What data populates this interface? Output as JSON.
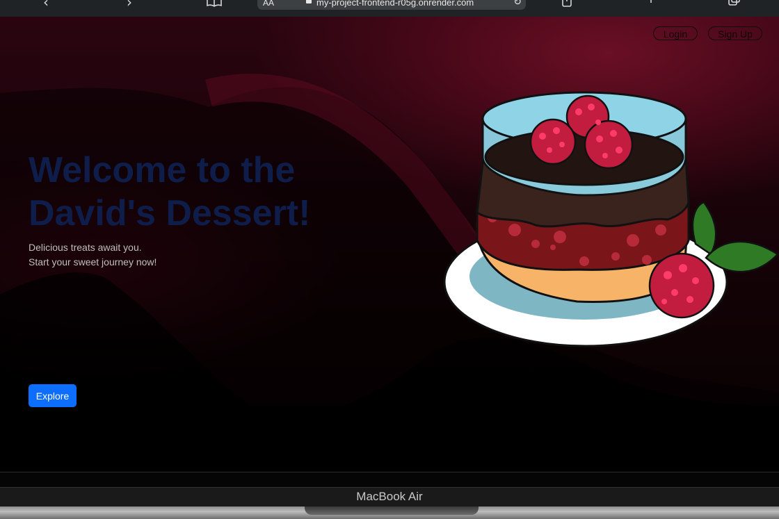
{
  "browser": {
    "text_size_label": "AA",
    "url": "my-project-frontend-r05g.onrender.com"
  },
  "nav": {
    "login_label": "Login",
    "signup_label": "Sign Up"
  },
  "hero": {
    "heading_line1": "Welcome to the",
    "heading_line2": "David's Dessert!",
    "tagline_line1": "Delicious treats await you.",
    "tagline_line2": "Start your sweet journey now!",
    "explore_label": "Explore",
    "image_subject": "raspberry-layer-cake-illustration"
  },
  "device": {
    "brand_label": "MacBook Air"
  },
  "colors": {
    "heading": "#0f1d4a",
    "primary_button": "#0d6efd",
    "accent": "#6a0f25"
  }
}
